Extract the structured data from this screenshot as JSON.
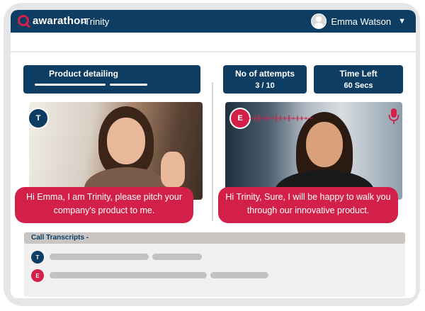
{
  "colors": {
    "brand_navy": "#0e3d63",
    "accent_red": "#d32049",
    "frame_gray": "#e6e6e6"
  },
  "app": {
    "logo_text": "awarathon",
    "window_title": "-Trinity"
  },
  "user": {
    "name": "Emma Watson",
    "avatar_icon": "user-avatar-icon",
    "menu_icon": "caret-down-icon"
  },
  "cards": {
    "product": {
      "title": "Product detailing"
    },
    "attempts": {
      "title": "No of attempts",
      "value": "3 / 10"
    },
    "time": {
      "title": "Time Left",
      "value": "60 Secs"
    }
  },
  "participants": {
    "trinity": {
      "initial": "T",
      "message": "Hi Emma, I am Trinity, please pitch your company's product to me."
    },
    "emma": {
      "initial": "E",
      "message": "Hi Trinity, Sure, I will be happy to walk you through our innovative product."
    }
  },
  "transcripts": {
    "title": "Call Transcripts -",
    "rows": [
      {
        "initial": "T"
      },
      {
        "initial": "E"
      }
    ]
  }
}
